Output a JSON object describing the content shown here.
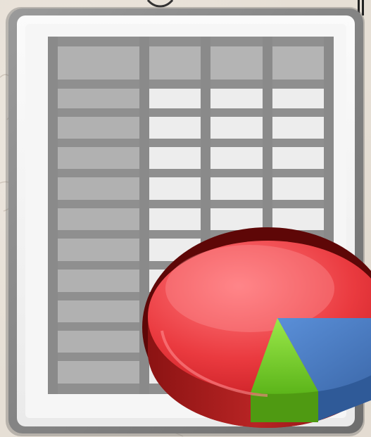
{
  "icon": {
    "name": "spreadsheet-with-pie-chart",
    "colors": {
      "background": "#e6dfd5",
      "frame": "#8a8a8a",
      "paper": "#f4f4f4",
      "header_cells": "#b3b3b3",
      "body_cells": "#ececec",
      "grid_lines": "#8c8c8c",
      "pie_red": "#e8343a",
      "pie_red_dark": "#a81c1c",
      "pie_outline": "#6b0b0b",
      "pie_blue": "#4a7cc6",
      "pie_green": "#74d41c"
    }
  }
}
